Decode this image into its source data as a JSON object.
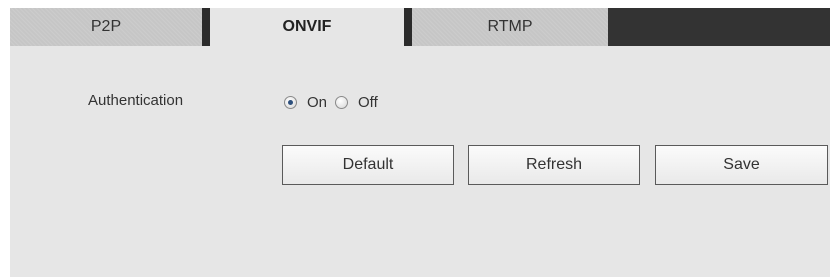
{
  "tabs": [
    {
      "label": "P2P",
      "active": false
    },
    {
      "label": "ONVIF",
      "active": true
    },
    {
      "label": "RTMP",
      "active": false
    }
  ],
  "authentication": {
    "label": "Authentication",
    "options": [
      {
        "label": "On",
        "checked": true
      },
      {
        "label": "Off",
        "checked": false
      }
    ]
  },
  "buttons": {
    "default_label": "Default",
    "refresh_label": "Refresh",
    "save_label": "Save"
  },
  "colors": {
    "panel_background": "#e6e6e6",
    "inactive_tab": "#c6c6c6",
    "tab_separator": "#2b2b2b",
    "radio_checked": "#2d4f7c"
  }
}
